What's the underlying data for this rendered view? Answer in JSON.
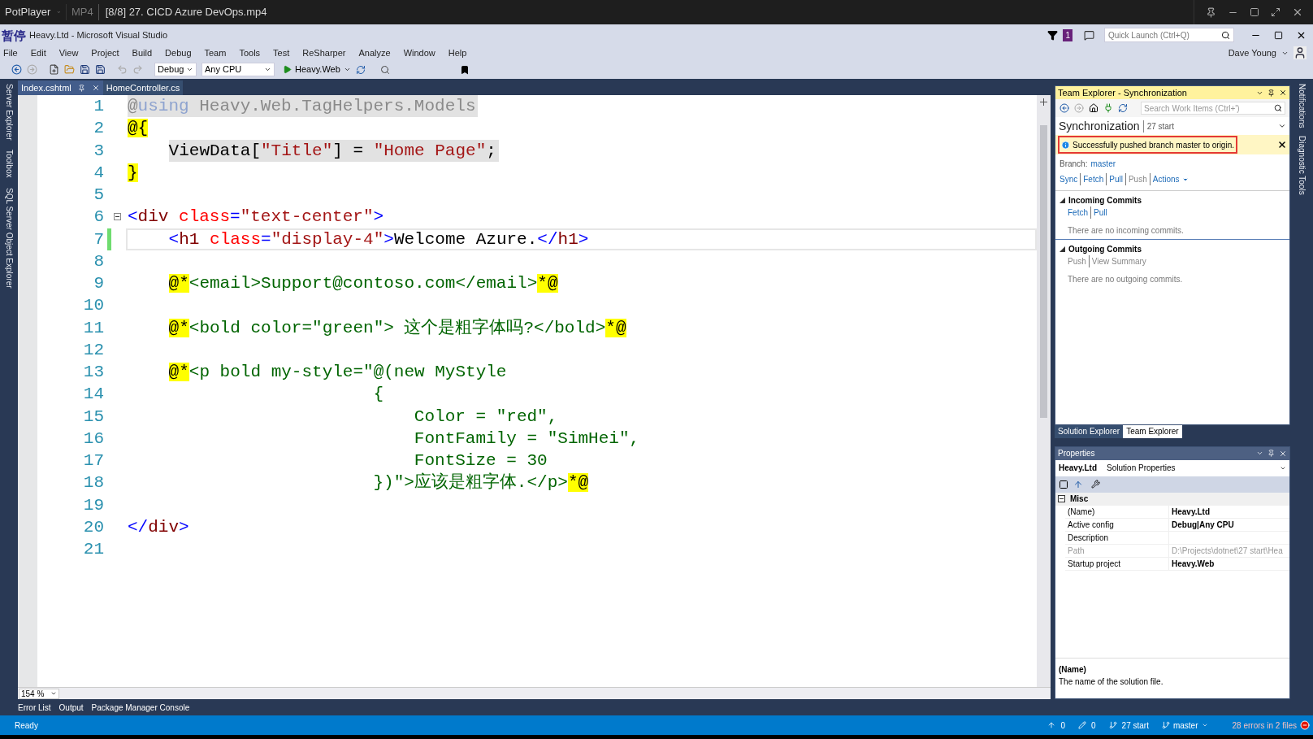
{
  "player": {
    "app": "PotPlayer",
    "format": "MP4",
    "title": "[8/8] 27. CICD Azure DevOps.mp4",
    "osd": "暂停"
  },
  "vs": {
    "title": "Heavy.Ltd - Microsoft Visual Studio",
    "notification_count": "1",
    "quick_launch_placeholder": "Quick Launch (Ctrl+Q)",
    "user": "Dave Young",
    "menu": [
      "File",
      "Edit",
      "View",
      "Project",
      "Build",
      "Debug",
      "Team",
      "Tools",
      "Test",
      "ReSharper",
      "Analyze",
      "Window",
      "Help"
    ],
    "toolbar": {
      "config": "Debug",
      "platform": "Any CPU",
      "run_target": "Heavy.Web"
    }
  },
  "left_tool_windows": [
    "Server Explorer",
    "Toolbox",
    "SQL Server Object Explorer"
  ],
  "right_tool_windows": [
    "Notifications",
    "Diagnostic Tools"
  ],
  "editor": {
    "tabs": [
      {
        "label": "Index.cshtml",
        "selected": true
      },
      {
        "label": "HomeController.cs",
        "selected": false
      }
    ],
    "zoom": "154 %",
    "lines": [
      {
        "number": "1",
        "indented": false,
        "shaded": true,
        "current": false,
        "modified": false,
        "tokens": [
          {
            "kind": "dim",
            "t": "@"
          },
          {
            "kind": "kwdim",
            "t": "using"
          },
          {
            "kind": "dim",
            "t": " Heavy.Web.TagHelpers.Models"
          }
        ]
      },
      {
        "number": "2",
        "indented": false,
        "shaded": false,
        "current": false,
        "modified": false,
        "tokens": [
          {
            "kind": "razor",
            "t": "@{"
          }
        ]
      },
      {
        "number": "3",
        "indented": true,
        "shaded": true,
        "current": false,
        "modified": false,
        "tokens": [
          {
            "kind": "plain",
            "t": "ViewData["
          },
          {
            "kind": "string",
            "t": "\"Title\""
          },
          {
            "kind": "plain",
            "t": "] = "
          },
          {
            "kind": "string",
            "t": "\"Home Page\""
          },
          {
            "kind": "plain",
            "t": ";"
          }
        ]
      },
      {
        "number": "4",
        "indented": false,
        "shaded": false,
        "current": false,
        "modified": false,
        "tokens": [
          {
            "kind": "razor",
            "t": "}"
          }
        ]
      },
      {
        "number": "5",
        "current": false,
        "modified": false
      },
      {
        "number": "6",
        "indented": false,
        "shaded": false,
        "current": false,
        "modified": false,
        "tokens": [
          {
            "kind": "delim",
            "t": "<"
          },
          {
            "kind": "tag",
            "t": "div"
          },
          {
            "kind": "attr",
            "t": " class"
          },
          {
            "kind": "delim",
            "t": "="
          },
          {
            "kind": "string",
            "t": "\"text-center\""
          },
          {
            "kind": "delim",
            "t": ">"
          }
        ]
      },
      {
        "number": "7",
        "indented": true,
        "shaded": false,
        "current": true,
        "modified": true,
        "tokens": [
          {
            "kind": "delim",
            "t": "<"
          },
          {
            "kind": "tag",
            "t": "h1"
          },
          {
            "kind": "attr",
            "t": " class"
          },
          {
            "kind": "delim",
            "t": "="
          },
          {
            "kind": "string",
            "t": "\"display-4\""
          },
          {
            "kind": "delim",
            "t": ">"
          },
          {
            "kind": "plain",
            "t": "Welcome Azure."
          },
          {
            "kind": "delim",
            "t": "</"
          },
          {
            "kind": "tag",
            "t": "h1"
          },
          {
            "kind": "delim",
            "t": ">"
          }
        ]
      },
      {
        "number": "8",
        "current": false,
        "modified": false
      },
      {
        "number": "9",
        "indented": true,
        "shaded": false,
        "current": false,
        "modified": false,
        "tokens": [
          {
            "kind": "razor",
            "t": "@*"
          },
          {
            "kind": "comment",
            "t": "<email>Support@contoso.com</email>"
          },
          {
            "kind": "razor",
            "t": "*@"
          }
        ]
      },
      {
        "number": "10",
        "current": false,
        "modified": false
      },
      {
        "number": "11",
        "indented": true,
        "shaded": false,
        "current": false,
        "modified": false,
        "tokens": [
          {
            "kind": "razor",
            "t": "@*"
          },
          {
            "kind": "comment",
            "t": "<bold color=\"green\"> 这个是粗字体吗?</bold>"
          },
          {
            "kind": "razor",
            "t": "*@"
          }
        ]
      },
      {
        "number": "12",
        "current": false,
        "modified": false
      },
      {
        "number": "13",
        "indented": true,
        "shaded": false,
        "current": false,
        "modified": false,
        "tokens": [
          {
            "kind": "razor",
            "t": "@*"
          },
          {
            "kind": "comment",
            "t": "<p bold my-style=\"@(new MyStyle"
          }
        ]
      },
      {
        "number": "14",
        "indented": false,
        "shaded": false,
        "current": false,
        "modified": false,
        "tokens": [
          {
            "kind": "comment",
            "t": "                        {"
          }
        ]
      },
      {
        "number": "15",
        "indented": false,
        "shaded": false,
        "current": false,
        "modified": false,
        "tokens": [
          {
            "kind": "comment",
            "t": "                            Color = \"red\","
          }
        ]
      },
      {
        "number": "16",
        "indented": false,
        "shaded": false,
        "current": false,
        "modified": false,
        "tokens": [
          {
            "kind": "comment",
            "t": "                            FontFamily = \"SimHei\","
          }
        ]
      },
      {
        "number": "17",
        "indented": false,
        "shaded": false,
        "current": false,
        "modified": false,
        "tokens": [
          {
            "kind": "comment",
            "t": "                            FontSize = 30"
          }
        ]
      },
      {
        "number": "18",
        "indented": false,
        "shaded": false,
        "current": false,
        "modified": false,
        "tokens": [
          {
            "kind": "comment",
            "t": "                        })\">应该是粗字体.</p>"
          },
          {
            "kind": "razor",
            "t": "*@"
          }
        ]
      },
      {
        "number": "19",
        "current": false,
        "modified": false
      },
      {
        "number": "20",
        "indented": false,
        "shaded": false,
        "current": false,
        "modified": false,
        "tokens": [
          {
            "kind": "delim",
            "t": "</"
          },
          {
            "kind": "tag",
            "t": "div"
          },
          {
            "kind": "delim",
            "t": ">"
          }
        ]
      },
      {
        "number": "21",
        "current": false,
        "modified": false
      }
    ]
  },
  "team_explorer": {
    "title": "Team Explorer - Synchronization",
    "search_placeholder": "Search Work Items (Ctrl+')",
    "heading": "Synchronization",
    "context": "27 start",
    "notice": "Successfully pushed branch master to origin.",
    "branch_label": "Branch:",
    "branch": "master",
    "actions": [
      {
        "label": "Sync",
        "disabled": false,
        "kind": "link"
      },
      {
        "label": "Fetch",
        "disabled": false,
        "kind": "link"
      },
      {
        "label": "Pull",
        "disabled": false,
        "kind": "link"
      },
      {
        "label": "Push",
        "disabled": true,
        "kind": "link"
      },
      {
        "label": "Actions",
        "disabled": false,
        "kind": "menu"
      }
    ],
    "sections": [
      {
        "title": "Incoming Commits",
        "expanded": true,
        "links": [
          {
            "label": "Fetch",
            "disabled": false
          },
          {
            "label": "Pull",
            "disabled": false
          }
        ],
        "message": "There are no incoming commits."
      },
      {
        "title": "Outgoing Commits",
        "expanded": true,
        "links": [
          {
            "label": "Push",
            "disabled": true
          },
          {
            "label": "View Summary",
            "disabled": true
          }
        ],
        "message": "There are no outgoing commits."
      }
    ]
  },
  "panel_tabs": [
    {
      "label": "Solution Explorer",
      "selected": false
    },
    {
      "label": "Team Explorer",
      "selected": true
    }
  ],
  "properties": {
    "title": "Properties",
    "object": "Heavy.Ltd",
    "object_type": "Solution Properties",
    "category": "Misc",
    "rows": [
      {
        "name": "(Name)",
        "value": "Heavy.Ltd",
        "disabled": false
      },
      {
        "name": "Active config",
        "value": "Debug|Any CPU",
        "disabled": false
      },
      {
        "name": "Description",
        "disabled": false
      },
      {
        "name": "Path",
        "value": "D:\\Projects\\dotnet\\27 start\\Hea",
        "disabled": true
      },
      {
        "name": "Startup project",
        "value": "Heavy.Web",
        "disabled": false
      }
    ],
    "help_title": "(Name)",
    "help_text": "The name of the solution file."
  },
  "bottom_tabs": [
    "Error List",
    "Output",
    "Package Manager Console"
  ],
  "status_bar": {
    "state": "Ready",
    "pushes": "0",
    "changes": "0",
    "repo": "27 start",
    "branch": "master",
    "errors": "28 errors in 2 files"
  }
}
